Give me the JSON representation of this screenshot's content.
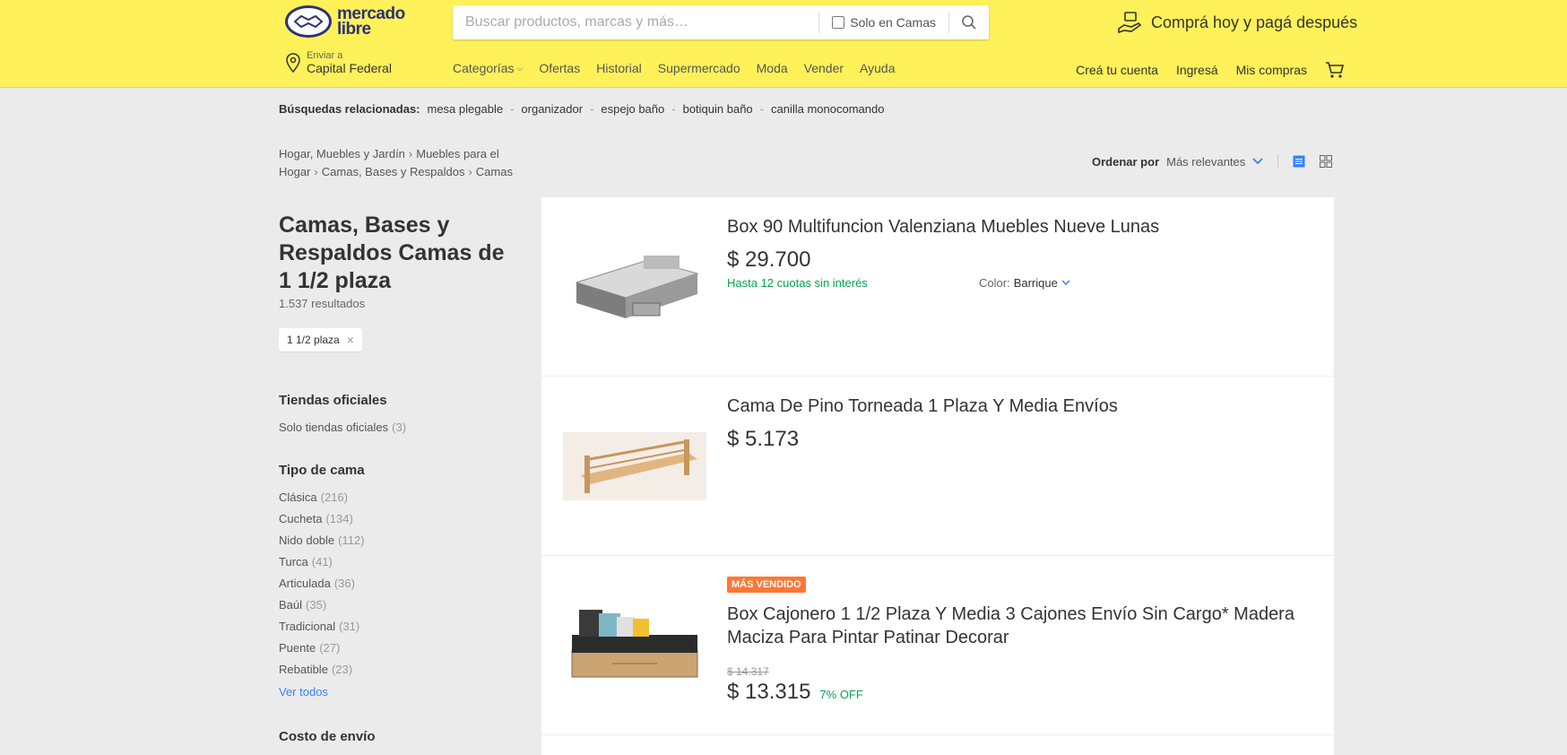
{
  "header": {
    "logo_text_1": "mercado",
    "logo_text_2": "libre",
    "search_placeholder": "Buscar productos, marcas y más…",
    "search_scope": "Solo en Camas",
    "promo": "Comprá hoy y pagá después",
    "location_label": "Enviar a",
    "location_value": "Capital Federal",
    "nav": [
      "Categorías",
      "Ofertas",
      "Historial",
      "Supermercado",
      "Moda",
      "Vender",
      "Ayuda"
    ],
    "nav_right": [
      "Creá tu cuenta",
      "Ingresá",
      "Mis compras"
    ]
  },
  "related": {
    "label": "Búsquedas relacionadas:",
    "items": [
      "mesa plegable",
      "organizador",
      "espejo baño",
      "botiquin baño",
      "canilla monocomando"
    ]
  },
  "breadcrumb": [
    "Hogar, Muebles y Jardín",
    "Muebles para el Hogar",
    "Camas, Bases y Respaldos",
    "Camas"
  ],
  "page_title": "Camas, Bases y Respaldos Camas de 1 1/2 plaza",
  "results": "1.537 resultados",
  "active_filter": "1 1/2 plaza",
  "filters": {
    "tiendas_title": "Tiendas oficiales",
    "tiendas": [
      {
        "label": "Solo tiendas oficiales",
        "count": "(3)"
      }
    ],
    "tipo_title": "Tipo de cama",
    "tipo": [
      {
        "label": "Clásica",
        "count": "(216)"
      },
      {
        "label": "Cucheta",
        "count": "(134)"
      },
      {
        "label": "Nido doble",
        "count": "(112)"
      },
      {
        "label": "Turca",
        "count": "(41)"
      },
      {
        "label": "Articulada",
        "count": "(36)"
      },
      {
        "label": "Baúl",
        "count": "(35)"
      },
      {
        "label": "Tradicional",
        "count": "(31)"
      },
      {
        "label": "Puente",
        "count": "(27)"
      },
      {
        "label": "Rebatible",
        "count": "(23)"
      }
    ],
    "ver_todos": "Ver todos",
    "envio_title": "Costo de envío"
  },
  "sort": {
    "label": "Ordenar por",
    "value": "Más relevantes"
  },
  "products": [
    {
      "name": "Box 90 Multifuncion Valenziana Muebles Nueve Lunas",
      "price": "$ 29.700",
      "installments": "Hasta 12 cuotas sin interés",
      "color_label": "Color:",
      "color_value": "Barrique"
    },
    {
      "name": "Cama De Pino Torneada 1 Plaza Y Media Envíos",
      "price": "$ 5.173"
    },
    {
      "badge": "MÁS VENDIDO",
      "name": "Box Cajonero 1 1/2 Plaza Y Media 3 Cajones Envío Sin Cargo* Madera Maciza Para Pintar Patinar Decorar",
      "old_price": "$ 14.317",
      "price": "$ 13.315",
      "discount": "7% OFF"
    }
  ],
  "colors": {
    "header_bg": "#fff159",
    "link": "#3483fa",
    "green": "#00a650",
    "badge": "#ff7733"
  }
}
